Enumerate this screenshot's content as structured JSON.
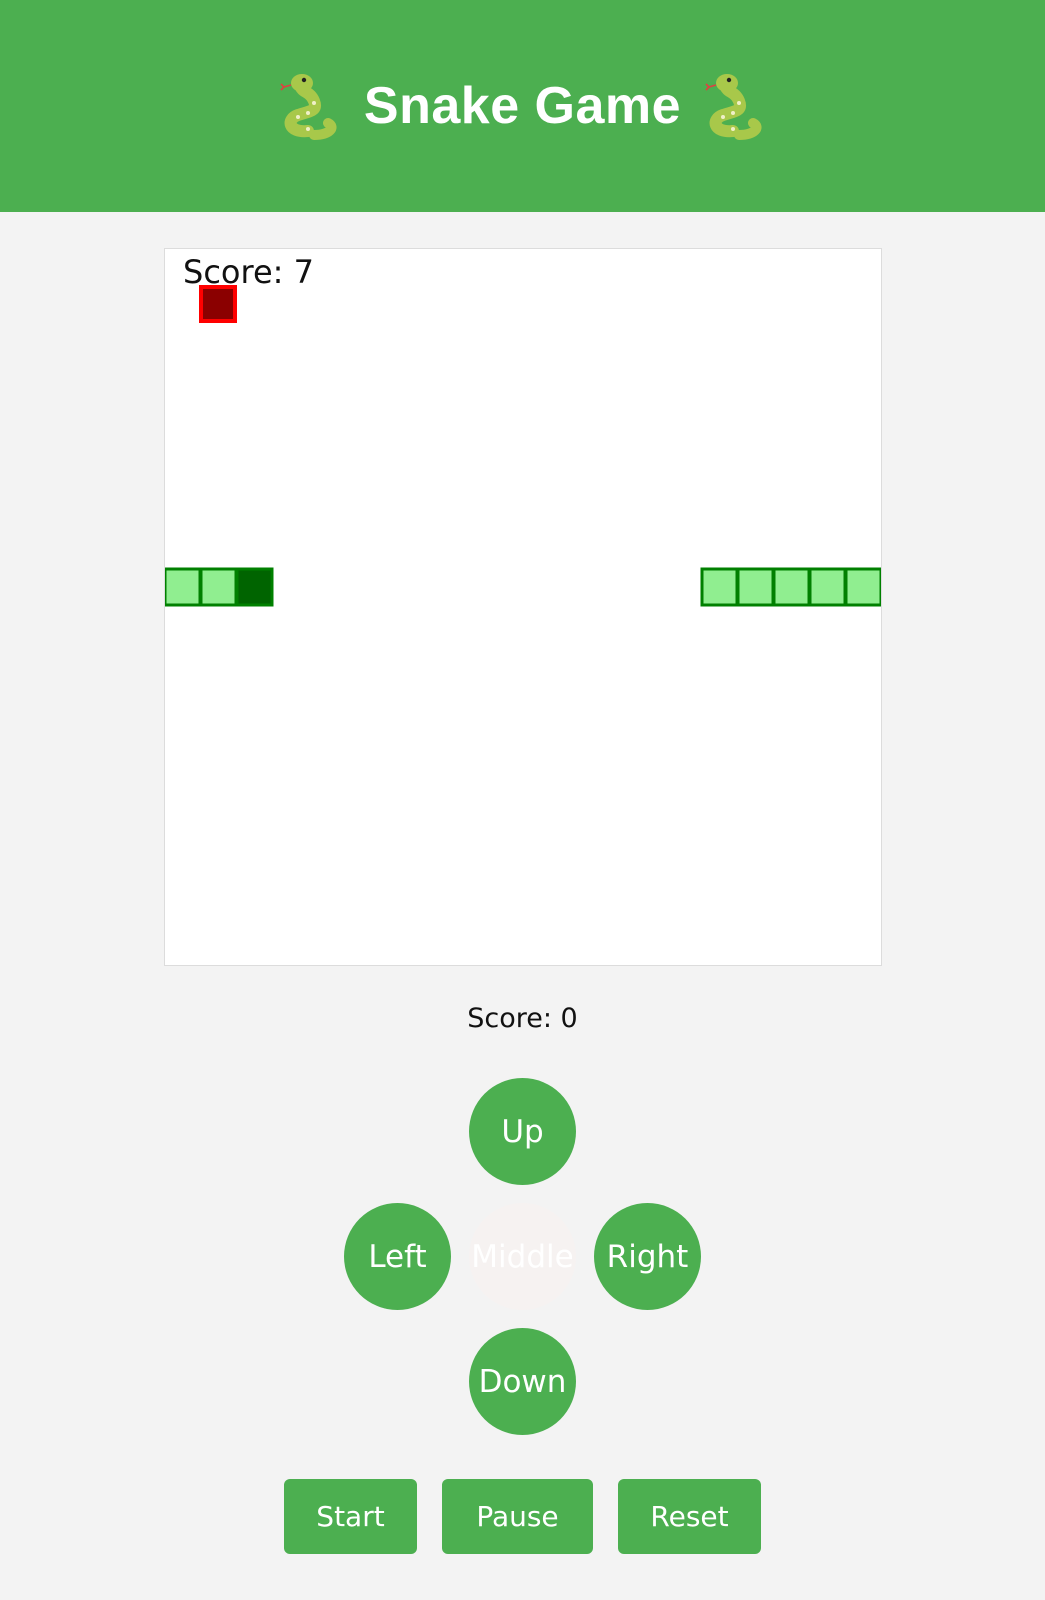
{
  "header": {
    "title": "Snake Game",
    "left_icon": "snake-emoji",
    "right_icon": "snake-emoji"
  },
  "game": {
    "canvas_score_label": "Score: 7",
    "outer_score_label": "Score: 0",
    "colors": {
      "header": "#4caf50",
      "snake_body": "#90ee90",
      "snake_head": "#006400",
      "snake_border": "#008000",
      "food_fill": "#8b0000",
      "food_border": "#ff0000"
    }
  },
  "dpad": {
    "up": "Up",
    "left": "Left",
    "middle": "Middle",
    "right": "Right",
    "down": "Down"
  },
  "controls": {
    "start": "Start",
    "pause": "Pause",
    "reset": "Reset"
  }
}
